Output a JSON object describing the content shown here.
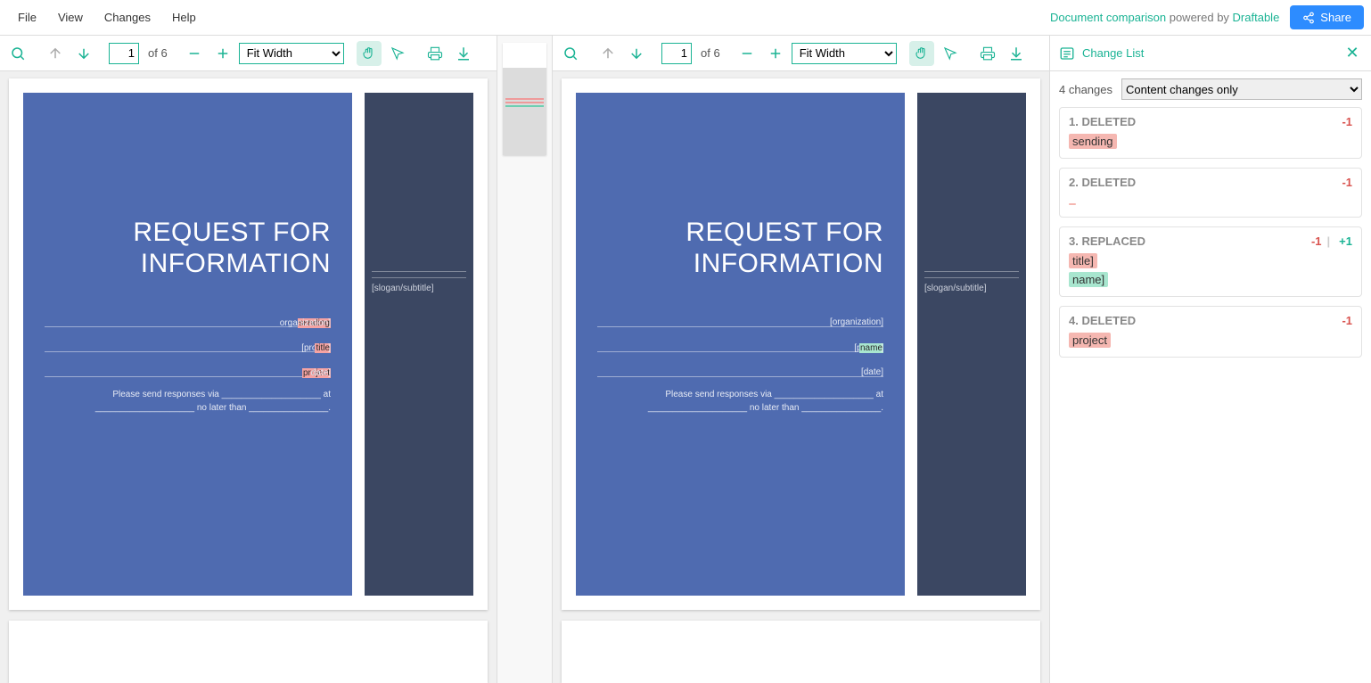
{
  "menubar": {
    "items": [
      "File",
      "View",
      "Changes",
      "Help"
    ]
  },
  "brand": {
    "dc": "Document comparison",
    "powered": " powered by ",
    "draftable": "Draftable"
  },
  "share_label": "Share",
  "toolbar": {
    "page_value": "1",
    "page_of": "of 6",
    "zoom": "Fit Width"
  },
  "doc": {
    "title1": "REQUEST FOR",
    "title2": "INFORMATION",
    "subtitle": "[slogan/subtitle]",
    "left_fields": {
      "f1_pre": "[",
      "f1_del": "sending",
      "f1_post": " organization]",
      "f2_pre": "[project ",
      "f2_del": "title",
      "f2_post": "]",
      "f3_pre": "[",
      "f3_del": "project",
      "f3_post": " date]"
    },
    "right_fields": {
      "f1": "[organization]",
      "f2_pre": "[project ",
      "f2_add": "name",
      "f2_post": "]",
      "f3": "[date]"
    },
    "resp1_a": "Please send responses via ",
    "resp1_b": " at",
    "resp2_a": " no later than ",
    "resp2_b": "."
  },
  "change_panel": {
    "title": "Change List",
    "count": "4 changes",
    "filter": "Content changes only",
    "changes": [
      {
        "head": "1. DELETED",
        "minus": "-1",
        "plus": "",
        "del": "sending ",
        "add": ""
      },
      {
        "head": "2. DELETED",
        "minus": "-1",
        "plus": "",
        "del": " ",
        "add": ""
      },
      {
        "head": "3. REPLACED",
        "minus": "-1",
        "plus": "+1",
        "del": "title]",
        "add": "name]"
      },
      {
        "head": "4. DELETED",
        "minus": "-1",
        "plus": "",
        "del": "project ",
        "add": ""
      }
    ]
  }
}
